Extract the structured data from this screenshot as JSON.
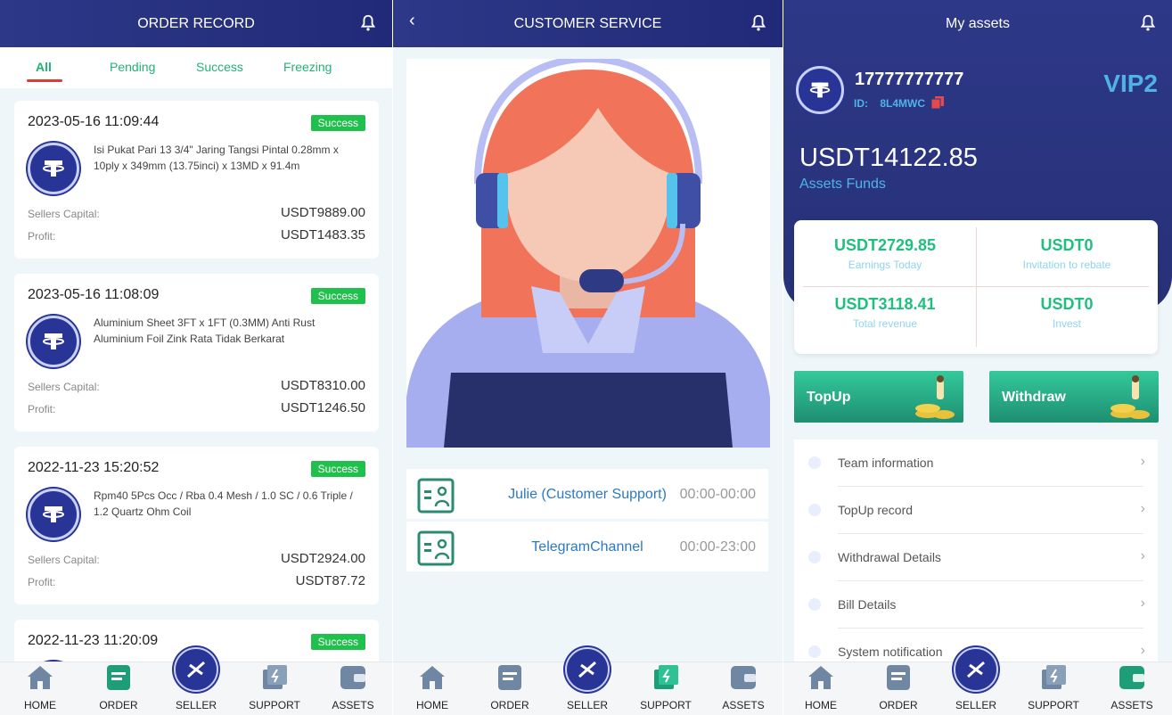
{
  "orders": {
    "title": "ORDER RECORD",
    "tabs": [
      "All",
      "Pending",
      "Success",
      "Freezing"
    ],
    "capital_label": "Sellers Capital:",
    "profit_label": "Profit:",
    "items": [
      {
        "date": "2023-05-16 11:09:44",
        "status": "Success",
        "desc": "Isi Pukat Pari 13 3/4\" Jaring Tangsi Pintal 0.28mm x 10ply x 349mm (13.75inci) x 13MD x 91.4m",
        "capital": "USDT9889.00",
        "profit": "USDT1483.35"
      },
      {
        "date": "2023-05-16 11:08:09",
        "status": "Success",
        "desc": "Aluminium Sheet 3FT x 1FT (0.3MM) Anti Rust Aluminium Foil Zink Rata Tidak Berkarat",
        "capital": "USDT8310.00",
        "profit": "USDT1246.50"
      },
      {
        "date": "2022-11-23 15:20:52",
        "status": "Success",
        "desc": "Rpm40 5Pcs Occ / Rba 0.4 Mesh / 1.0 SC / 0.6 Triple / 1.2 Quartz Ohm Coil",
        "capital": "USDT2924.00",
        "profit": "USDT87.72"
      },
      {
        "date": "2022-11-23 11:20:09",
        "status": "Success"
      }
    ]
  },
  "service": {
    "title": "CUSTOMER SERVICE",
    "contacts": [
      {
        "name": "Julie (Customer Support)",
        "hours": "00:00-00:00"
      },
      {
        "name": "TelegramChannel",
        "hours": "00:00-23:00"
      }
    ]
  },
  "assets": {
    "title": "My assets",
    "phone": "17777777777",
    "id_label": "ID:",
    "id": "8L4MWC",
    "vip": "VIP2",
    "balance": "USDT14122.85",
    "balance_label": "Assets Funds",
    "stats": [
      {
        "value": "USDT2729.85",
        "label": "Earnings Today"
      },
      {
        "value": "USDT0",
        "label": "Invitation to rebate"
      },
      {
        "value": "USDT3118.41",
        "label": "Total revenue"
      },
      {
        "value": "USDT0",
        "label": "Invest"
      }
    ],
    "topup": "TopUp",
    "withdraw": "Withdraw",
    "menu": [
      "Team information",
      "TopUp record",
      "Withdrawal Details",
      "Bill Details",
      "System notification"
    ]
  },
  "nav": [
    "HOME",
    "ORDER",
    "SELLER",
    "SUPPORT",
    "ASSETS"
  ],
  "colors": {
    "header": "#2d3888",
    "accent_green": "#1fc14c",
    "link_blue": "#2b79c6",
    "teal": "#23b178"
  },
  "icons": [
    "bell-icon",
    "back-icon",
    "tether-logo-icon",
    "contact-card-icon",
    "copy-icon",
    "chevron-right-icon",
    "home-icon",
    "order-icon",
    "seller-icon",
    "support-icon",
    "wallet-icon"
  ]
}
